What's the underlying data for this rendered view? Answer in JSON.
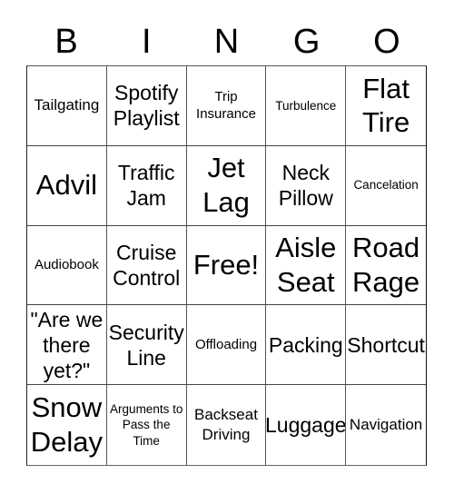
{
  "header": {
    "letters": [
      "B",
      "I",
      "N",
      "G",
      "O"
    ]
  },
  "cells": [
    {
      "text": "Tailgating",
      "size": "md"
    },
    {
      "text": "Spotify Playlist",
      "size": "lg"
    },
    {
      "text": "Trip Insurance",
      "size": "sm"
    },
    {
      "text": "Turbulence",
      "size": "xs"
    },
    {
      "text": "Flat Tire",
      "size": "xl"
    },
    {
      "text": "Advil",
      "size": "xl"
    },
    {
      "text": "Traffic Jam",
      "size": "lg"
    },
    {
      "text": "Jet Lag",
      "size": "xl"
    },
    {
      "text": "Neck Pillow",
      "size": "lg"
    },
    {
      "text": "Cancelation",
      "size": "xs"
    },
    {
      "text": "Audiobook",
      "size": "sm"
    },
    {
      "text": "Cruise Control",
      "size": "lg"
    },
    {
      "text": "Free!",
      "size": "xl"
    },
    {
      "text": "Aisle Seat",
      "size": "xl"
    },
    {
      "text": "Road Rage",
      "size": "xl"
    },
    {
      "text": "\"Are we there yet?\"",
      "size": "lg"
    },
    {
      "text": "Security Line",
      "size": "lg"
    },
    {
      "text": "Offloading",
      "size": "sm"
    },
    {
      "text": "Packing",
      "size": "lg"
    },
    {
      "text": "Shortcut",
      "size": "lg"
    },
    {
      "text": "Snow Delay",
      "size": "xl"
    },
    {
      "text": "Arguments to Pass the Time",
      "size": "xs"
    },
    {
      "text": "Backseat Driving",
      "size": "md"
    },
    {
      "text": "Luggage",
      "size": "lg"
    },
    {
      "text": "Navigation",
      "size": "md"
    }
  ]
}
